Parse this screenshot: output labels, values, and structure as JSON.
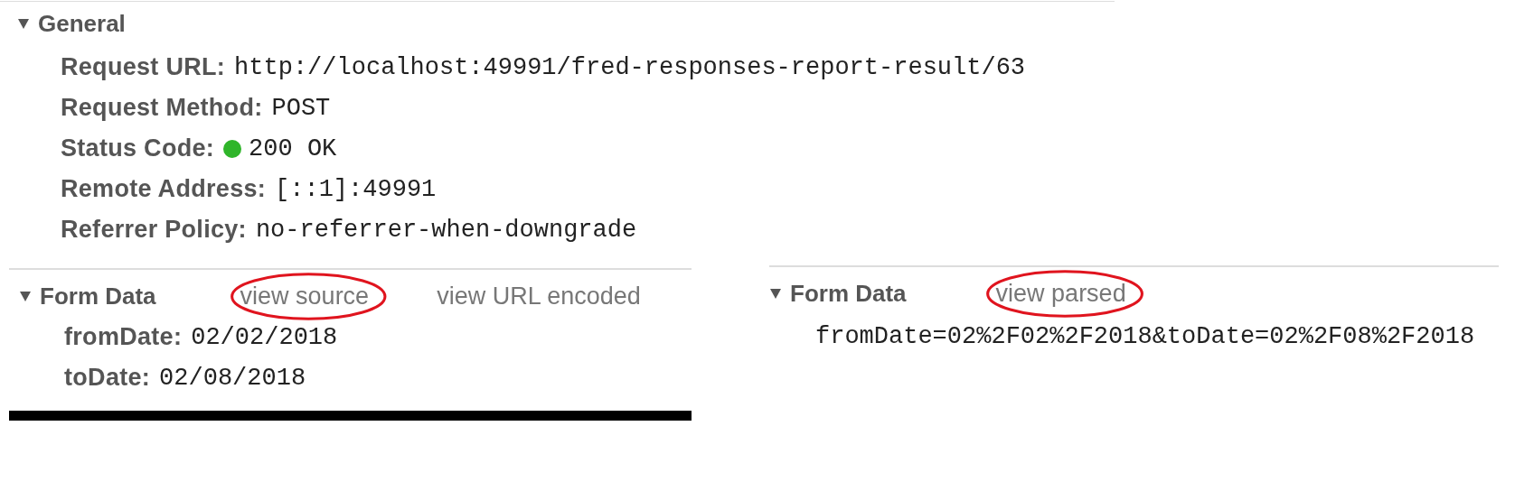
{
  "general": {
    "title": "General",
    "expanded": true,
    "fields": [
      {
        "label": "Request URL:",
        "value": "http://localhost:49991/fred-responses-report-result/63"
      },
      {
        "label": "Request Method:",
        "value": "POST"
      },
      {
        "label": "Status Code:",
        "value": "200 OK",
        "color": "#2fb52a"
      },
      {
        "label": "Remote Address:",
        "value": "[::1]:49991"
      },
      {
        "label": "Referrer Policy:",
        "value": "no-referrer-when-downgrade"
      }
    ]
  },
  "form_data_parsed": {
    "title": "Form Data",
    "expanded": true,
    "links": [
      {
        "text": "view source",
        "circled": true
      },
      {
        "text": "view URL encoded",
        "circled": false
      }
    ],
    "fields": [
      {
        "label": "fromDate:",
        "value": "02/02/2018"
      },
      {
        "label": "toDate:",
        "value": "02/08/2018"
      }
    ]
  },
  "form_data_source": {
    "title": "Form Data",
    "expanded": true,
    "links": [
      {
        "text": "view parsed",
        "circled": true
      }
    ],
    "raw": "fromDate=02%2F02%2F2018&toDate=02%2F08%2F2018"
  }
}
